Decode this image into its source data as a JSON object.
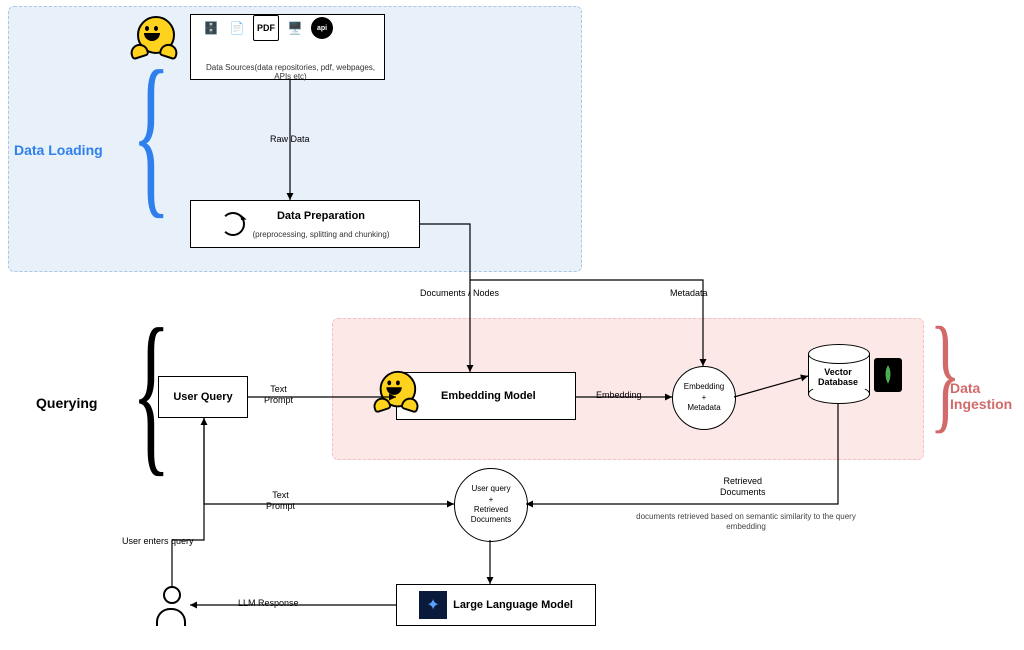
{
  "sections": {
    "data_loading": "Data Loading",
    "data_ingestion": "Data Ingestion",
    "querying": "Querying"
  },
  "colors": {
    "data_loading_region": "#e8f1fa",
    "data_ingestion_region": "#fde8e8",
    "section_data_loading_text": "#2f80ed",
    "section_data_ingestion_text": "#d36a6a",
    "section_querying_text": "#000000"
  },
  "nodes": {
    "data_sources": {
      "caption": "Data Sources(data repositories, pdf, webpages, APIs etc)",
      "icons": [
        "database-icon",
        "document-icon",
        "pdf-icon",
        "webpage-icon",
        "api-icon"
      ]
    },
    "data_preparation": {
      "title": "Data Preparation",
      "subtitle": "(preprocessing, splitting and chunking)"
    },
    "user_query": {
      "title": "User Query"
    },
    "embedding_model": {
      "title": "Embedding Model"
    },
    "embedding_metadata": {
      "line1": "Embedding",
      "line2": "+",
      "line3": "Metadata"
    },
    "vector_database": {
      "title": "Vector\nDatabase",
      "side_icon": "mongodb-leaf-icon"
    },
    "query_docs_bundle": {
      "line1": "User query",
      "line2": "+",
      "line3": "Retrieved",
      "line4": "Documents"
    },
    "llm": {
      "title": "Large Language Model"
    },
    "user": {
      "label": "user"
    }
  },
  "edges": {
    "raw_data": "Raw Data",
    "documents_nodes": "Documents / Nodes",
    "metadata": "Metadata",
    "text_prompt_1": "Text\nPrompt",
    "embedding": "Embedding",
    "retrieved_documents": "Retrieved\nDocuments",
    "retrieved_note": "documents retrieved based\non semantic similarity to the query embedding",
    "text_prompt_2": "Text\nPrompt",
    "user_enters_query": "User enters query",
    "llm_response": "LLM Response"
  }
}
